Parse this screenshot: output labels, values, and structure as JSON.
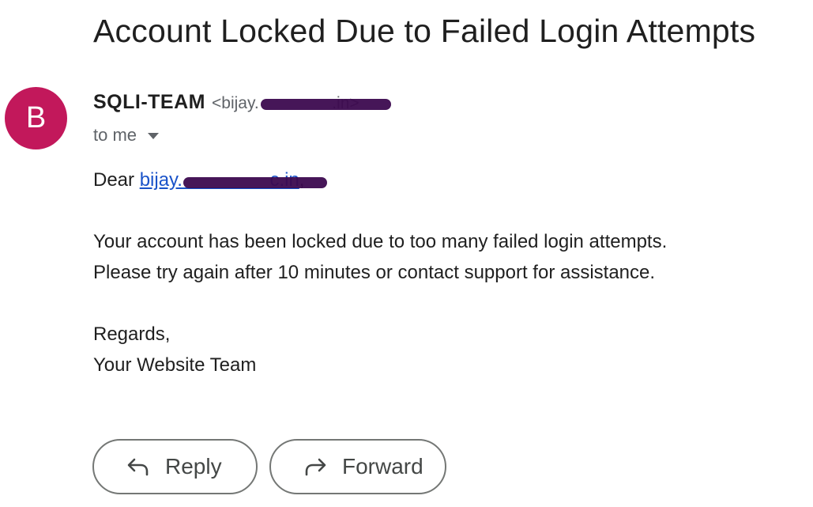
{
  "email": {
    "subject": "Account Locked Due to Failed Login Attempts",
    "avatar_letter": "B",
    "sender": {
      "name": "SQLI-TEAM",
      "email": "<bijay.                      .in>"
    },
    "recipient_label": "to me",
    "body": {
      "greeting_prefix": "Dear ",
      "greeting_link": "bijay.                       c.in",
      "greeting_suffix": ",",
      "line1": "Your account has been locked due to too many failed login attempts.",
      "line2": "Please try again after 10 minutes or contact support for assistance.",
      "closing1": "Regards,",
      "closing2": "Your Website Team"
    }
  },
  "actions": {
    "reply_label": "Reply",
    "forward_label": "Forward",
    "reply_icon": "reply-arrow-icon",
    "forward_icon": "forward-arrow-icon"
  },
  "colors": {
    "avatar_bg": "#c2185b",
    "link": "#1a53c9",
    "redaction": "#3c0a4f"
  }
}
